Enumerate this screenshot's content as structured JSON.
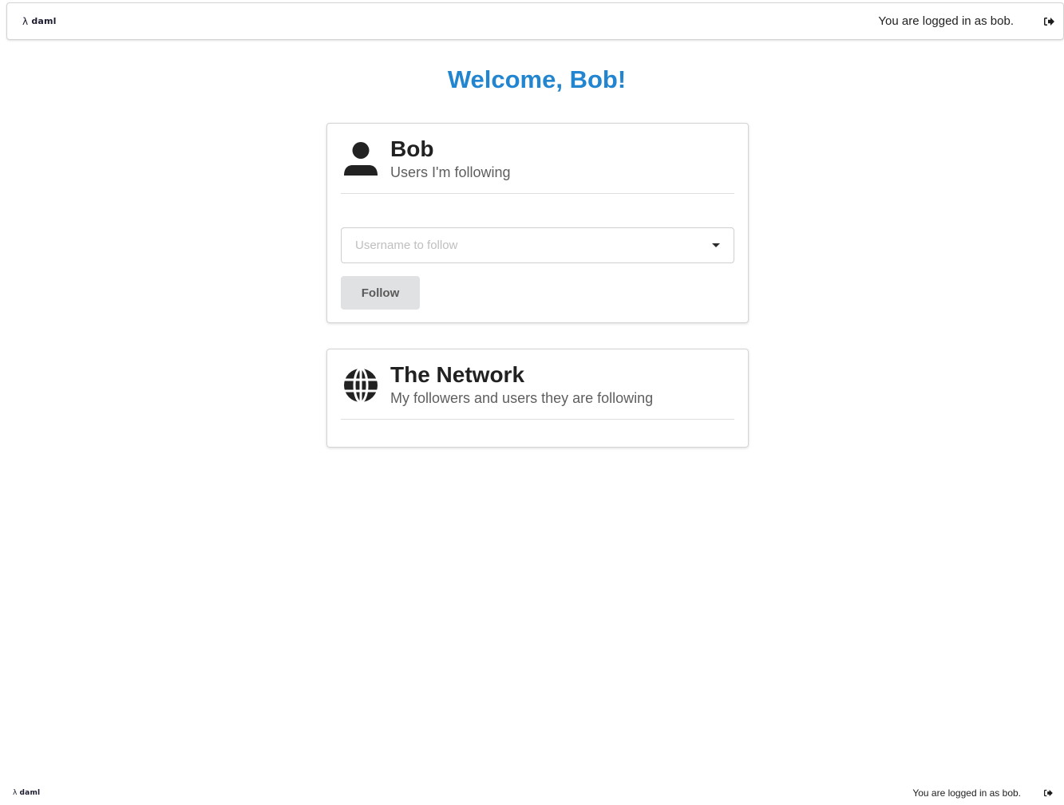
{
  "header": {
    "brand_mark": "λ",
    "brand_name": "daml",
    "logged_in_text": "You are logged in as bob.",
    "logout_icon": "sign-out-icon"
  },
  "main": {
    "welcome": "Welcome, Bob!",
    "user_card": {
      "icon": "user-icon",
      "title": "Bob",
      "subtitle": "Users I'm following",
      "select_placeholder": "Username to follow",
      "follow_label": "Follow"
    },
    "network_card": {
      "icon": "globe-icon",
      "title": "The Network",
      "subtitle": "My followers and users they are following"
    }
  },
  "footer": {
    "brand_mark": "λ",
    "brand_name": "daml",
    "logged_in_text": "You are logged in as bob.",
    "logout_icon": "sign-out-icon"
  },
  "colors": {
    "accent": "#2185d0",
    "button_bg": "#e0e1e2"
  }
}
